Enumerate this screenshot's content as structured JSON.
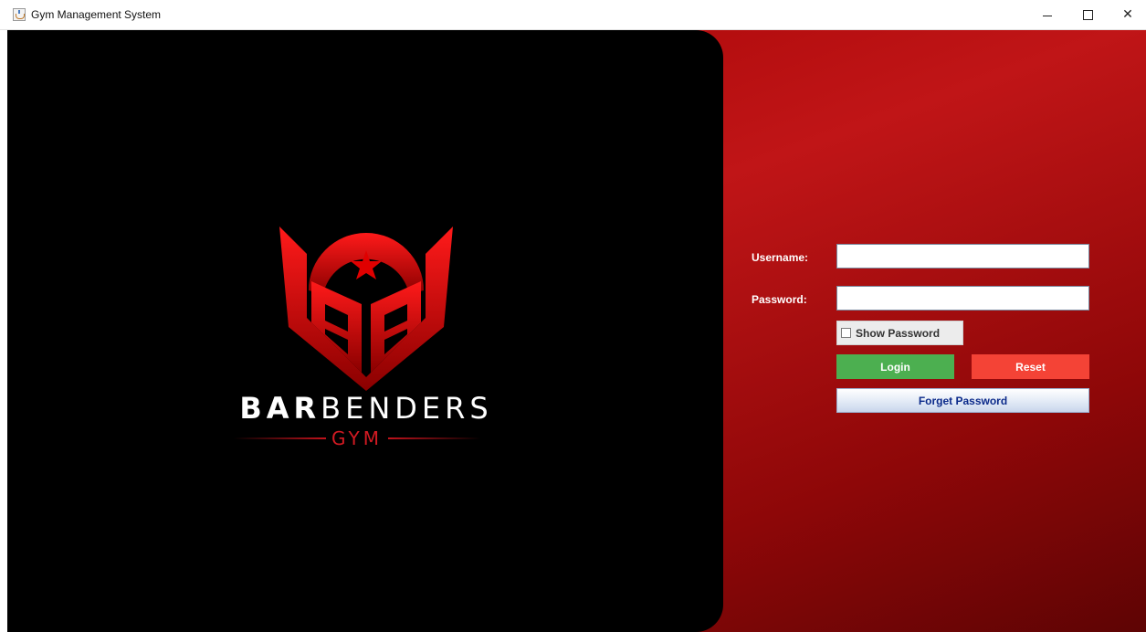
{
  "window": {
    "title": "Gym Management System",
    "controls": {
      "minimize": "minimize",
      "maximize": "maximize",
      "close": "close"
    }
  },
  "branding": {
    "name_bold": "BAR",
    "name_light": "BENDERS",
    "sub": "GYM",
    "logo_icon": "bb-shield-star-logo"
  },
  "login_form": {
    "username_label": "Username:",
    "username_value": "",
    "password_label": "Password:",
    "password_value": "",
    "show_password_label": "Show Password",
    "show_password_checked": false,
    "login_label": "Login",
    "reset_label": "Reset",
    "forget_label": "Forget Password"
  },
  "colors": {
    "panel_background": "#000000",
    "form_background": "#b01014",
    "login_button": "#4caf50",
    "reset_button": "#f44336",
    "forget_text": "#0b2a8a"
  }
}
